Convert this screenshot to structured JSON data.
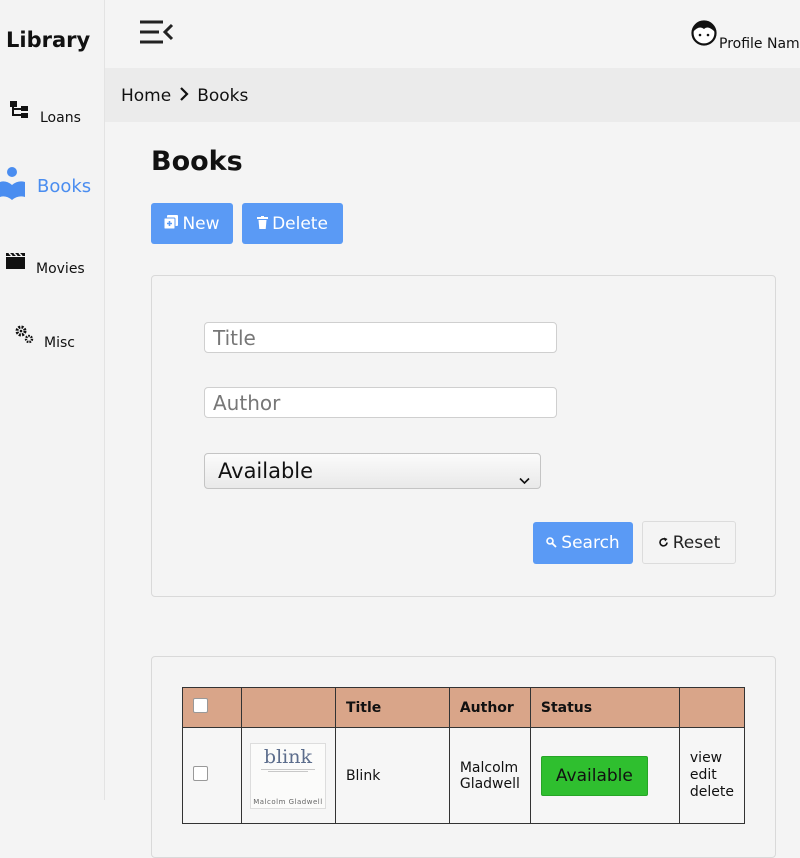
{
  "app": {
    "brand": "Library"
  },
  "sidebar": {
    "items": [
      {
        "label": "Loans",
        "icon": "sitemap-icon",
        "active": false
      },
      {
        "label": "Books",
        "icon": "book-reader-icon",
        "active": true
      },
      {
        "label": "Movies",
        "icon": "clapperboard-icon",
        "active": false
      },
      {
        "label": "Misc",
        "icon": "gears-icon",
        "active": false
      }
    ]
  },
  "topbar": {
    "menu_icon": "menu-collapse-icon",
    "profile_name": "Profile Name",
    "profile_icon": "user-face-icon"
  },
  "breadcrumb": {
    "home": "Home",
    "current": "Books"
  },
  "page": {
    "title": "Books"
  },
  "toolbar": {
    "new_label": "New",
    "delete_label": "Delete"
  },
  "search": {
    "title_placeholder": "Title",
    "author_placeholder": "Author",
    "status_selected": "Available",
    "search_label": "Search",
    "reset_label": "Reset"
  },
  "table": {
    "headers": {
      "title": "Title",
      "author": "Author",
      "status": "Status"
    },
    "rows": [
      {
        "title": "Blink",
        "author": "Malcolm Gladwell",
        "status": "Available",
        "cover_title": "blink",
        "cover_author": "Malcolm Gladwell",
        "actions": [
          "view",
          "edit",
          "delete"
        ]
      }
    ]
  },
  "colors": {
    "accent": "#5a9af5",
    "active_nav": "#4a8df0",
    "header_row": "#d9a589",
    "available": "#2fbf2f"
  }
}
